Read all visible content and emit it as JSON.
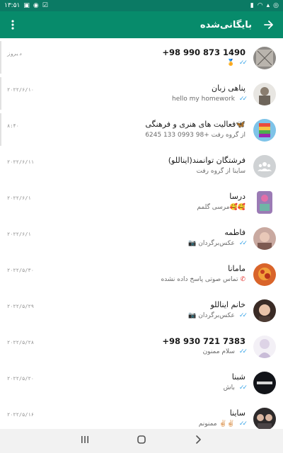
{
  "status_bar": {
    "time": "۱۳:۵۱",
    "left_icons": [
      "whatsapp-icon",
      "notification-icon",
      "wifi-icon",
      "battery-icon"
    ],
    "right_icons": [
      "checkbox-icon",
      "vpn-icon",
      "image-icon"
    ]
  },
  "app_bar": {
    "title": "بایگانی‌شده",
    "back_icon": "arrow-right-icon",
    "menu_icon": "more-vertical-icon",
    "color": "#078b6b"
  },
  "chats": [
    {
      "name": "+98 990 873 1490",
      "time": "دیروز",
      "preview": "🏅",
      "ticks": true,
      "bold": true
    },
    {
      "name": "پناهی زبان",
      "time": "۲۰۲۲/۶/۱۰",
      "preview": "hello  my homework",
      "ticks": true
    },
    {
      "name": "فعالیت های هنری و فرهنگی🦋",
      "time": "۸:۴۰",
      "preview": "6245 133 0993 98+ از گروه رفت",
      "ticks": false
    },
    {
      "name": "فرشتگان توانمند(ایناللو)",
      "time": "۲۰۲۲/۶/۱۱",
      "preview": "ساینا از گروه رفت",
      "ticks": false
    },
    {
      "name": "درسا",
      "time": "۲۰۲۲/۶/۱",
      "preview": "مرسی گلمم🥰🥰",
      "ticks": false
    },
    {
      "name": "فاطمه",
      "time": "۲۰۲۲/۶/۱",
      "preview": "📷 عکس‌برگردان",
      "ticks": true
    },
    {
      "name": "مامانا",
      "time": "۲۰۲۲/۵/۳۰",
      "preview": "تماس صوتی پاسخ داده نشده",
      "ticks": false,
      "missed_call": true
    },
    {
      "name": "خانم ایناللو",
      "time": "۲۰۲۲/۵/۲۹",
      "preview": "📷 عکس‌برگردان",
      "ticks": true
    },
    {
      "name": "+98 930 721 7383",
      "time": "۲۰۲۲/۵/۲۸",
      "preview": "سلام ممنون",
      "ticks": true,
      "bold": true
    },
    {
      "name": "شبنا",
      "time": "۲۰۲۲/۵/۲۰",
      "preview": "باش",
      "ticks": true
    },
    {
      "name": "ساینا",
      "time": "۲۰۲۲/۵/۱۶",
      "preview": "ممنونم ✌🏻✌🏻",
      "ticks": true
    }
  ],
  "nav_bar": {
    "recents_icon": "recents-icon",
    "home_icon": "home-icon",
    "back_icon": "back-icon"
  }
}
